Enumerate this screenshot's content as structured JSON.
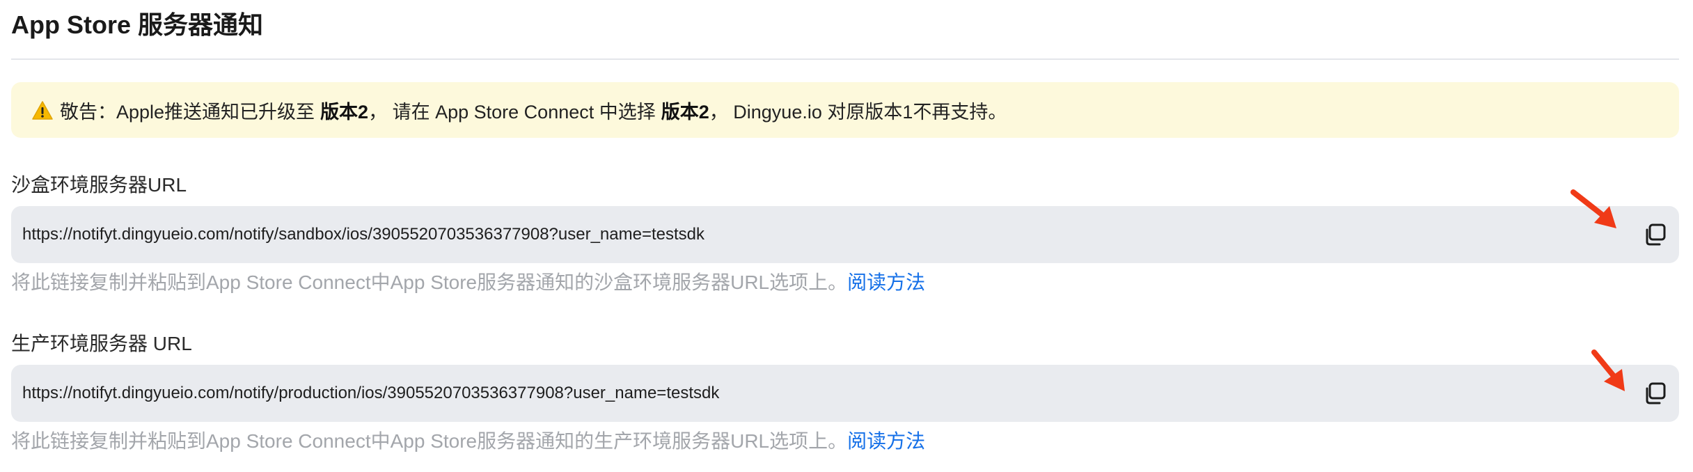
{
  "header": {
    "title": "App Store 服务器通知"
  },
  "warning": {
    "icon": "warning-icon",
    "prefix": "敬告：Apple推送通知已升级至",
    "version_1": "版本2",
    "middle": "， 请在 App Store Connect 中选择",
    "version_2": "版本2",
    "suffix": "， Dingyue.io 对原版本1不再支持。",
    "background_color": "#fdf9dc"
  },
  "sandbox": {
    "label": "沙盒环境服务器URL",
    "url": "https://notifyt.dingyueio.com/notify/sandbox/ios/3905520703536377908?user_name=testsdk",
    "copy_icon": "copy-icon",
    "hint": "将此链接复制并粘贴到App Store Connect中App Store服务器通知的沙盒环境服务器URL选项上。",
    "hint_link": "阅读方法"
  },
  "production": {
    "label": "生产环境服务器 URL",
    "url": "https://notifyt.dingyueio.com/notify/production/ios/3905520703536377908?user_name=testsdk",
    "copy_icon": "copy-icon",
    "hint": "将此链接复制并粘贴到App Store Connect中App Store服务器通知的生产环境服务器URL选项上。",
    "hint_link": "阅读方法"
  },
  "colors": {
    "link": "#1570e8",
    "annotation_arrow": "#f03a17",
    "url_box_background": "#e9ebef",
    "hint_text": "#a3a6ab"
  }
}
